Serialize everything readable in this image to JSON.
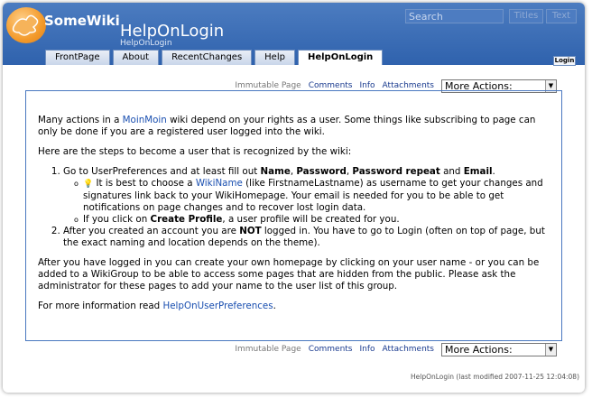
{
  "header": {
    "logo_text": "SomeWiki",
    "page_name": "HelpOnLogin",
    "page_sub": "HelpOnLogin",
    "search_placeholder": "Search",
    "titles_button": "Titles",
    "text_button": "Text",
    "accent_color": "#2f62ad"
  },
  "tabs": [
    "FrontPage",
    "About",
    "RecentChanges",
    "Help",
    "HelpOnLogin"
  ],
  "login_label": "Login",
  "actions": {
    "immutable": "Immutable Page",
    "comments": "Comments",
    "info": "Info",
    "attachments": "Attachments",
    "more_actions": "More Actions:"
  },
  "content": {
    "p1_a": "Many actions in a ",
    "p1_link": "MoinMoin",
    "p1_b": " wiki depend on your rights as a user. Some things like subscribing to page can only be done if you are a registered user logged into the wiki.",
    "p2": "Here are the steps to become a user that is recognized by the wiki:",
    "step1_a": "Go to UserPreferences and at least fill out ",
    "step1_name": "Name",
    "step1_sep1": ", ",
    "step1_password": "Password",
    "step1_sep2": ", ",
    "step1_password_repeat": "Password repeat",
    "step1_and": " and ",
    "step1_email": "Email",
    "step1_end": ".",
    "sub1_a": " It is best to choose a ",
    "sub1_link": "WikiName",
    "sub1_b": " (like FirstnameLastname) as username to get your changes and signatures link back to your WikiHomepage. Your email is needed for you to be able to get notifications on page changes and to recover lost login data.",
    "sub2_a": "If you click on ",
    "sub2_bold": "Create Profile",
    "sub2_b": ", a user profile will be created for you.",
    "step2_a": "After you created an account you are ",
    "step2_bold": "NOT",
    "step2_b": " logged in. You have to go to Login (often on top of page, but the exact naming and location depends on the theme).",
    "p3": "After you have logged in you can create your own homepage by clicking on your user name - or you can be added to a WikiGroup to be able to access some pages that are hidden from the public. Please ask the administrator for these pages to add your name to the user list of this group.",
    "p4_a": "For more information read ",
    "p4_link": "HelpOnUserPreferences",
    "p4_b": "."
  },
  "footer": "HelpOnLogin (last modified 2007-11-25 12:04:08)"
}
